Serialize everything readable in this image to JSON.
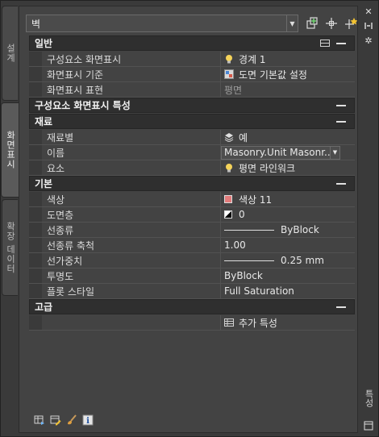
{
  "object_selector": {
    "value": "벽"
  },
  "left_tabs": {
    "design": "설계",
    "display": "화면표시",
    "extended_data": "확장 데이터"
  },
  "categories": {
    "general": {
      "title": "일반",
      "rows": [
        {
          "name": "구성요소 화면표시",
          "value": "경계 1",
          "icon": "lightbulb-icon"
        },
        {
          "name": "화면표시 기준",
          "value": "도면 기본값 설정",
          "icon": "drawing-default-icon"
        },
        {
          "name": "화면표시 표현",
          "value": "평면",
          "dim": true
        }
      ]
    },
    "component_display": {
      "title": "구성요소 화면표시 특성"
    },
    "material": {
      "title": "재료",
      "rows": [
        {
          "name": "재료별",
          "value": "예",
          "icon": "material-layers-icon"
        },
        {
          "name": "이름",
          "value": "Masonry.Unit  Masonr..."
        },
        {
          "name": "요소",
          "value": "평면 라인워크",
          "icon": "lightbulb-icon"
        }
      ]
    },
    "basic": {
      "title": "기본",
      "rows": [
        {
          "name": "색상",
          "value": "색상 11",
          "color": "#e37b7b"
        },
        {
          "name": "도면층",
          "value": "0"
        },
        {
          "name": "선종류",
          "value": "ByBlock"
        },
        {
          "name": "선종류 축척",
          "value": "1.00"
        },
        {
          "name": "선가중치",
          "value": "0.25 mm"
        },
        {
          "name": "투명도",
          "value": "ByBlock"
        },
        {
          "name": "플롯 스타일",
          "value": "Full Saturation"
        }
      ]
    },
    "advanced": {
      "title": "고급",
      "rows": [
        {
          "name": "",
          "value": "추가 특성",
          "icon": "table-icon"
        }
      ]
    }
  },
  "right_bar": {
    "label": "특성"
  },
  "colors": {
    "panel": "#434343",
    "category": "#2f2f2f",
    "accent_red": "#e37b7b"
  }
}
